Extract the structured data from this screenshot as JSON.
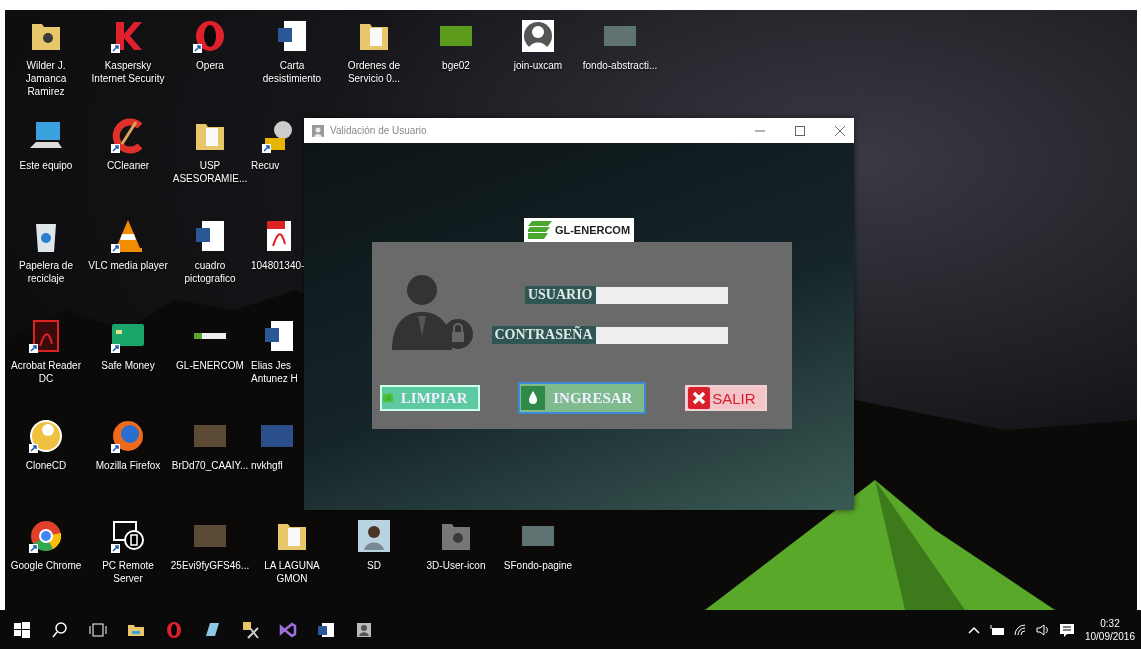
{
  "desktop": {
    "rows": [
      [
        {
          "label": "Wilder J. Jamanca Ramirez",
          "kind": "folder-user",
          "shortcut": false
        },
        {
          "label": "Kaspersky Internet Security",
          "kind": "kaspersky",
          "shortcut": true
        },
        {
          "label": "Opera",
          "kind": "opera",
          "shortcut": true
        },
        {
          "label": "Carta desistimiento",
          "kind": "word",
          "shortcut": false
        },
        {
          "label": "Ordenes de Servicio 0...",
          "kind": "folder-doc",
          "shortcut": false
        },
        {
          "label": "bge02",
          "kind": "image-green",
          "shortcut": false
        },
        {
          "label": "join-uxcam",
          "kind": "avatar",
          "shortcut": false
        },
        {
          "label": "fondo-abstracti...",
          "kind": "image-grey",
          "shortcut": false
        }
      ],
      [
        {
          "label": "Este equipo",
          "kind": "computer",
          "shortcut": false
        },
        {
          "label": "CCleaner",
          "kind": "ccleaner",
          "shortcut": true
        },
        {
          "label": "USP ASESORAMIE...",
          "kind": "folder-doc",
          "shortcut": false
        },
        {
          "label": "Recuv",
          "kind": "recuva",
          "shortcut": true
        }
      ],
      [
        {
          "label": "Papelera de reciclaje",
          "kind": "recycle",
          "shortcut": false
        },
        {
          "label": "VLC media player",
          "kind": "cone",
          "shortcut": true
        },
        {
          "label": "cuadro pictografico",
          "kind": "word",
          "shortcut": false
        },
        {
          "label": "104801340-",
          "kind": "pdf",
          "shortcut": false
        }
      ],
      [
        {
          "label": "Acrobat Reader DC",
          "kind": "acrobat",
          "shortcut": true
        },
        {
          "label": "Safe Money",
          "kind": "card",
          "shortcut": true
        },
        {
          "label": "GL-ENERCOM",
          "kind": "logo-small",
          "shortcut": false
        },
        {
          "label": "Elias Jes Antunez H",
          "kind": "word",
          "shortcut": false
        }
      ],
      [
        {
          "label": "CloneCD",
          "kind": "clonecd",
          "shortcut": true
        },
        {
          "label": "Mozilla Firefox",
          "kind": "firefox",
          "shortcut": true
        },
        {
          "label": "BrDd70_CAAIY...",
          "kind": "photo",
          "shortcut": false
        },
        {
          "label": "nvkhgfl",
          "kind": "photo-blue",
          "shortcut": false
        }
      ],
      [
        {
          "label": "Google Chrome",
          "kind": "chrome",
          "shortcut": true
        },
        {
          "label": "PC Remote Server",
          "kind": "remote",
          "shortcut": true
        },
        {
          "label": "25Evi9fyGFS46...",
          "kind": "photo",
          "shortcut": false
        },
        {
          "label": "LA LAGUNA GMON",
          "kind": "folder-doc",
          "shortcut": false
        },
        {
          "label": "SD",
          "kind": "avatar-photo",
          "shortcut": false
        },
        {
          "label": "3D-User-icon",
          "kind": "folder-user-grey",
          "shortcut": false
        },
        {
          "label": "SFondo-pagine",
          "kind": "image-grey",
          "shortcut": false
        }
      ]
    ]
  },
  "dialog": {
    "title": "Validación de Usuario",
    "logo": "GL-ENERCOM",
    "fields": [
      {
        "label": "USUARIO"
      },
      {
        "label": "CONTRASEÑA"
      }
    ],
    "buttons": [
      {
        "label": "LIMPIAR",
        "kind": "clear",
        "focused": false
      },
      {
        "label": "INGRESAR",
        "kind": "enter",
        "focused": true
      },
      {
        "label": "SALIR",
        "kind": "exit",
        "focused": false
      }
    ]
  },
  "taskbar": {
    "items": [
      {
        "kind": "start"
      },
      {
        "kind": "search"
      },
      {
        "kind": "taskview"
      },
      {
        "kind": "explorer"
      },
      {
        "kind": "opera"
      },
      {
        "kind": "notes"
      },
      {
        "kind": "tools"
      },
      {
        "kind": "vs"
      },
      {
        "kind": "word"
      },
      {
        "kind": "contact"
      }
    ],
    "time": "0:32",
    "date": "10/09/2016"
  }
}
